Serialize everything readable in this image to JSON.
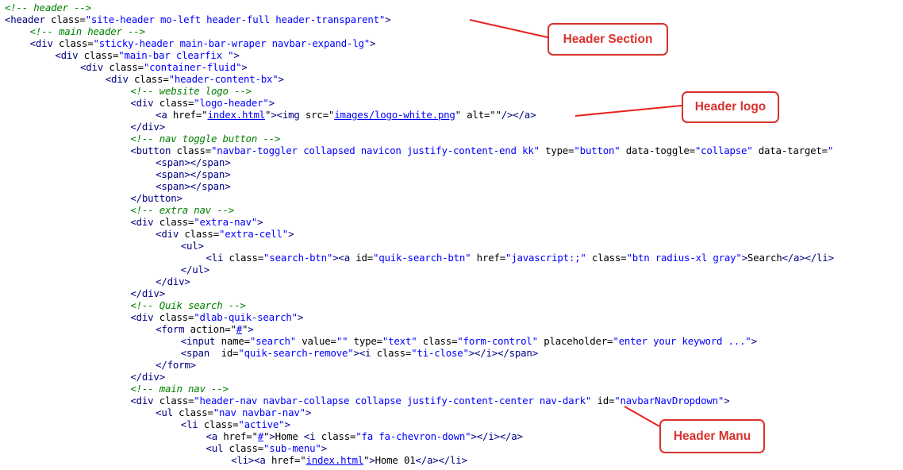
{
  "code": {
    "lines": [
      {
        "indent": 0,
        "tokens": [
          [
            "c",
            "<!-- header -->"
          ]
        ]
      },
      {
        "indent": 0,
        "tokens": [
          [
            "t",
            "<header "
          ],
          [
            "a",
            "class="
          ],
          [
            "v",
            "\"site-header mo-left header-full header-transparent\""
          ],
          [
            "t",
            ">"
          ]
        ]
      },
      {
        "indent": 4,
        "tokens": [
          [
            "c",
            "<!-- main header -->"
          ]
        ]
      },
      {
        "indent": 4,
        "tokens": [
          [
            "t",
            "<div "
          ],
          [
            "a",
            "class="
          ],
          [
            "v",
            "\"sticky-header main-bar-wraper navbar-expand-lg\""
          ],
          [
            "t",
            ">"
          ]
        ]
      },
      {
        "indent": 8,
        "tokens": [
          [
            "t",
            "<div "
          ],
          [
            "a",
            "class="
          ],
          [
            "v",
            "\"main-bar clearfix \""
          ],
          [
            "t",
            ">"
          ]
        ]
      },
      {
        "indent": 12,
        "tokens": [
          [
            "t",
            "<div "
          ],
          [
            "a",
            "class="
          ],
          [
            "v",
            "\"container-fluid\""
          ],
          [
            "t",
            ">"
          ]
        ]
      },
      {
        "indent": 16,
        "tokens": [
          [
            "t",
            "<div "
          ],
          [
            "a",
            "class="
          ],
          [
            "v",
            "\"header-content-bx\""
          ],
          [
            "t",
            ">"
          ]
        ]
      },
      {
        "indent": 20,
        "tokens": [
          [
            "c",
            "<!-- website logo -->"
          ]
        ]
      },
      {
        "indent": 20,
        "tokens": [
          [
            "t",
            "<div "
          ],
          [
            "a",
            "class="
          ],
          [
            "v",
            "\"logo-header\""
          ],
          [
            "t",
            ">"
          ]
        ]
      },
      {
        "indent": 24,
        "tokens": [
          [
            "t",
            "<a "
          ],
          [
            "a",
            "href="
          ],
          [
            "x",
            "\""
          ],
          [
            "l",
            "index.html"
          ],
          [
            "x",
            "\""
          ],
          [
            "t",
            "><img "
          ],
          [
            "a",
            "src="
          ],
          [
            "x",
            "\""
          ],
          [
            "l",
            "images/logo-white.png"
          ],
          [
            "x",
            "\""
          ],
          [
            "a",
            " alt="
          ],
          [
            "x",
            "\"\""
          ],
          [
            "t",
            "/></a>"
          ]
        ]
      },
      {
        "indent": 20,
        "tokens": [
          [
            "t",
            "</div>"
          ]
        ]
      },
      {
        "indent": 20,
        "tokens": [
          [
            "c",
            "<!-- nav toggle button -->"
          ]
        ]
      },
      {
        "indent": 20,
        "tokens": [
          [
            "t",
            "<button "
          ],
          [
            "a",
            "class="
          ],
          [
            "v",
            "\"navbar-toggler collapsed navicon justify-content-end kk\""
          ],
          [
            "a",
            " type="
          ],
          [
            "v",
            "\"button\""
          ],
          [
            "a",
            " data-toggle="
          ],
          [
            "v",
            "\"collapse\""
          ],
          [
            "a",
            " data-target="
          ],
          [
            "v",
            "\""
          ]
        ]
      },
      {
        "indent": 24,
        "tokens": [
          [
            "t",
            "<span></span>"
          ]
        ]
      },
      {
        "indent": 24,
        "tokens": [
          [
            "t",
            "<span></span>"
          ]
        ]
      },
      {
        "indent": 24,
        "tokens": [
          [
            "t",
            "<span></span>"
          ]
        ]
      },
      {
        "indent": 20,
        "tokens": [
          [
            "t",
            "</button>"
          ]
        ]
      },
      {
        "indent": 20,
        "tokens": [
          [
            "c",
            "<!-- extra nav -->"
          ]
        ]
      },
      {
        "indent": 20,
        "tokens": [
          [
            "t",
            "<div "
          ],
          [
            "a",
            "class="
          ],
          [
            "v",
            "\"extra-nav\""
          ],
          [
            "t",
            ">"
          ]
        ]
      },
      {
        "indent": 24,
        "tokens": [
          [
            "t",
            "<div "
          ],
          [
            "a",
            "class="
          ],
          [
            "v",
            "\"extra-cell\""
          ],
          [
            "t",
            ">"
          ]
        ]
      },
      {
        "indent": 28,
        "tokens": [
          [
            "t",
            "<ul>"
          ]
        ]
      },
      {
        "indent": 32,
        "tokens": [
          [
            "t",
            "<li "
          ],
          [
            "a",
            "class="
          ],
          [
            "v",
            "\"search-btn\""
          ],
          [
            "t",
            "><a "
          ],
          [
            "a",
            "id="
          ],
          [
            "v",
            "\"quik-search-btn\""
          ],
          [
            "a",
            " href="
          ],
          [
            "v",
            "\"javascript:;\""
          ],
          [
            "a",
            " class="
          ],
          [
            "v",
            "\"btn radius-xl gray\""
          ],
          [
            "t",
            ">"
          ],
          [
            "x",
            "Search"
          ],
          [
            "t",
            "</a></li>"
          ]
        ]
      },
      {
        "indent": 28,
        "tokens": [
          [
            "t",
            "</ul>"
          ]
        ]
      },
      {
        "indent": 24,
        "tokens": [
          [
            "t",
            "</div>"
          ]
        ]
      },
      {
        "indent": 20,
        "tokens": [
          [
            "t",
            "</div>"
          ]
        ]
      },
      {
        "indent": 20,
        "tokens": [
          [
            "c",
            "<!-- Quik search -->"
          ]
        ]
      },
      {
        "indent": 20,
        "tokens": [
          [
            "t",
            "<div "
          ],
          [
            "a",
            "class="
          ],
          [
            "v",
            "\"dlab-quik-search\""
          ],
          [
            "t",
            ">"
          ]
        ]
      },
      {
        "indent": 24,
        "tokens": [
          [
            "t",
            "<form "
          ],
          [
            "a",
            "action="
          ],
          [
            "x",
            "\""
          ],
          [
            "l",
            "#"
          ],
          [
            "x",
            "\""
          ],
          [
            "t",
            ">"
          ]
        ]
      },
      {
        "indent": 28,
        "tokens": [
          [
            "t",
            "<input "
          ],
          [
            "a",
            "name="
          ],
          [
            "v",
            "\"search\""
          ],
          [
            "a",
            " value="
          ],
          [
            "v",
            "\"\""
          ],
          [
            "a",
            " type="
          ],
          [
            "v",
            "\"text\""
          ],
          [
            "a",
            " class="
          ],
          [
            "v",
            "\"form-control\""
          ],
          [
            "a",
            " placeholder="
          ],
          [
            "v",
            "\"enter your keyword ...\""
          ],
          [
            "t",
            ">"
          ]
        ]
      },
      {
        "indent": 28,
        "tokens": [
          [
            "t",
            "<span  "
          ],
          [
            "a",
            "id="
          ],
          [
            "v",
            "\"quik-search-remove\""
          ],
          [
            "t",
            "><i "
          ],
          [
            "a",
            "class="
          ],
          [
            "v",
            "\"ti-close\""
          ],
          [
            "t",
            "></i></span>"
          ]
        ]
      },
      {
        "indent": 24,
        "tokens": [
          [
            "t",
            "</form>"
          ]
        ]
      },
      {
        "indent": 20,
        "tokens": [
          [
            "t",
            "</div>"
          ]
        ]
      },
      {
        "indent": 20,
        "tokens": [
          [
            "c",
            "<!-- main nav -->"
          ]
        ]
      },
      {
        "indent": 20,
        "tokens": [
          [
            "t",
            "<div "
          ],
          [
            "a",
            "class="
          ],
          [
            "v",
            "\"header-nav navbar-collapse collapse justify-content-center nav-dark\""
          ],
          [
            "a",
            " id="
          ],
          [
            "v",
            "\"navbarNavDropdown\""
          ],
          [
            "t",
            ">"
          ]
        ]
      },
      {
        "indent": 24,
        "tokens": [
          [
            "t",
            "<ul "
          ],
          [
            "a",
            "class="
          ],
          [
            "v",
            "\"nav navbar-nav\""
          ],
          [
            "t",
            ">"
          ]
        ]
      },
      {
        "indent": 28,
        "tokens": [
          [
            "t",
            "<li "
          ],
          [
            "a",
            "class="
          ],
          [
            "v",
            "\"active\""
          ],
          [
            "t",
            ">"
          ]
        ]
      },
      {
        "indent": 32,
        "tokens": [
          [
            "t",
            "<a "
          ],
          [
            "a",
            "href="
          ],
          [
            "x",
            "\""
          ],
          [
            "l",
            "#"
          ],
          [
            "x",
            "\""
          ],
          [
            "t",
            ">"
          ],
          [
            "x",
            "Home "
          ],
          [
            "t",
            "<i "
          ],
          [
            "a",
            "class="
          ],
          [
            "v",
            "\"fa fa-chevron-down\""
          ],
          [
            "t",
            "></i></a>"
          ]
        ]
      },
      {
        "indent": 32,
        "tokens": [
          [
            "t",
            "<ul "
          ],
          [
            "a",
            "class="
          ],
          [
            "v",
            "\"sub-menu\""
          ],
          [
            "t",
            ">"
          ]
        ]
      },
      {
        "indent": 36,
        "tokens": [
          [
            "t",
            "<li><a "
          ],
          [
            "a",
            "href="
          ],
          [
            "x",
            "\""
          ],
          [
            "l",
            "index.html"
          ],
          [
            "x",
            "\""
          ],
          [
            "t",
            ">"
          ],
          [
            "x",
            "Home 01"
          ],
          [
            "t",
            "</a></li>"
          ]
        ]
      }
    ]
  },
  "callouts": [
    {
      "id": "header-section",
      "label": "Header Section",
      "color": "#d8322d"
    },
    {
      "id": "header-logo",
      "label": "Header logo",
      "color": "#d8322d"
    },
    {
      "id": "header-menu",
      "label": "Header Manu",
      "color": "#d8322d"
    }
  ]
}
